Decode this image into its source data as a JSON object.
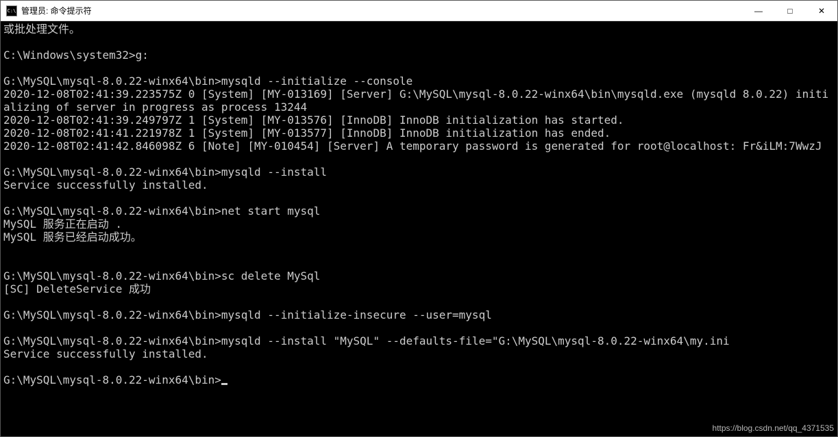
{
  "titlebar": {
    "icon_text": "C:\\",
    "title": "管理员: 命令提示符"
  },
  "window_controls": {
    "minimize": "—",
    "maximize": "□",
    "close": "✕"
  },
  "terminal": {
    "lines": [
      "或批处理文件。",
      "",
      "C:\\Windows\\system32>g:",
      "",
      "G:\\MySQL\\mysql-8.0.22-winx64\\bin>mysqld --initialize --console",
      "2020-12-08T02:41:39.223575Z 0 [System] [MY-013169] [Server] G:\\MySQL\\mysql-8.0.22-winx64\\bin\\mysqld.exe (mysqld 8.0.22) initializing of server in progress as process 13244",
      "2020-12-08T02:41:39.249797Z 1 [System] [MY-013576] [InnoDB] InnoDB initialization has started.",
      "2020-12-08T02:41:41.221978Z 1 [System] [MY-013577] [InnoDB] InnoDB initialization has ended.",
      "2020-12-08T02:41:42.846098Z 6 [Note] [MY-010454] [Server] A temporary password is generated for root@localhost: Fr&iLM:7WwzJ",
      "",
      "G:\\MySQL\\mysql-8.0.22-winx64\\bin>mysqld --install",
      "Service successfully installed.",
      "",
      "G:\\MySQL\\mysql-8.0.22-winx64\\bin>net start mysql",
      "MySQL 服务正在启动 .",
      "MySQL 服务已经启动成功。",
      "",
      "",
      "G:\\MySQL\\mysql-8.0.22-winx64\\bin>sc delete MySql",
      "[SC] DeleteService 成功",
      "",
      "G:\\MySQL\\mysql-8.0.22-winx64\\bin>mysqld --initialize-insecure --user=mysql",
      "",
      "G:\\MySQL\\mysql-8.0.22-winx64\\bin>mysqld --install \"MySQL\" --defaults-file=\"G:\\MySQL\\mysql-8.0.22-winx64\\my.ini",
      "Service successfully installed.",
      "",
      "G:\\MySQL\\mysql-8.0.22-winx64\\bin>"
    ]
  },
  "watermark": "https://blog.csdn.net/qq_4371535"
}
